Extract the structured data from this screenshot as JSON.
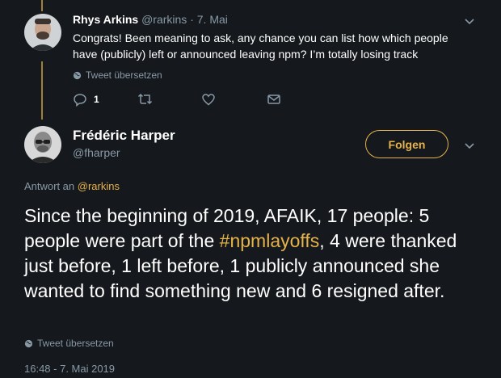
{
  "reply": {
    "name": "Rhys Arkins",
    "handle": "@rarkins",
    "separator": "·",
    "date": "7. Mai",
    "text": "Congrats! Been meaning to ask, any chance you can list how which people have (publicly) left or announced leaving npm? I’m totally losing track",
    "translate_label": "Tweet übersetzen",
    "reply_count": "1"
  },
  "main": {
    "name": "Frédéric Harper",
    "handle": "@fharper",
    "follow_label": "Folgen",
    "reply_to_prefix": "Antwort an ",
    "reply_to_handle": "@rarkins",
    "text_before": "Since the beginning of 2019, AFAIK, 17 people: 5 people were part of the ",
    "hashtag": "#npmlayoffs",
    "text_after": ", 4 were thanked just before, 1 left before, 1 publicly announced she wanted to find something new and 6 resigned after.",
    "translate_label": "Tweet übersetzen",
    "timestamp": "16:48 - 7. Mai 2019"
  },
  "colors": {
    "background": "#15181c",
    "accent": "#e6b34a",
    "muted": "#8899a6"
  },
  "icons": [
    "globe-icon",
    "reply-icon",
    "retweet-icon",
    "like-icon",
    "message-icon",
    "chevron-down-icon"
  ]
}
